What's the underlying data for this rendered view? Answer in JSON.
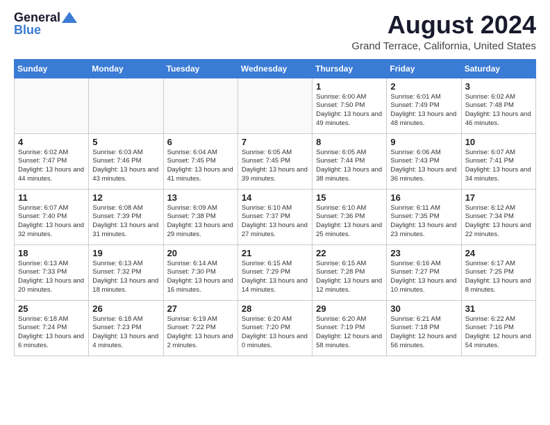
{
  "header": {
    "logo_line1": "General",
    "logo_line2": "Blue",
    "month_title": "August 2024",
    "location": "Grand Terrace, California, United States"
  },
  "days_of_week": [
    "Sunday",
    "Monday",
    "Tuesday",
    "Wednesday",
    "Thursday",
    "Friday",
    "Saturday"
  ],
  "weeks": [
    [
      {
        "day": "",
        "info": ""
      },
      {
        "day": "",
        "info": ""
      },
      {
        "day": "",
        "info": ""
      },
      {
        "day": "",
        "info": ""
      },
      {
        "day": "1",
        "info": "Sunrise: 6:00 AM\nSunset: 7:50 PM\nDaylight: 13 hours\nand 49 minutes."
      },
      {
        "day": "2",
        "info": "Sunrise: 6:01 AM\nSunset: 7:49 PM\nDaylight: 13 hours\nand 48 minutes."
      },
      {
        "day": "3",
        "info": "Sunrise: 6:02 AM\nSunset: 7:48 PM\nDaylight: 13 hours\nand 46 minutes."
      }
    ],
    [
      {
        "day": "4",
        "info": "Sunrise: 6:02 AM\nSunset: 7:47 PM\nDaylight: 13 hours\nand 44 minutes."
      },
      {
        "day": "5",
        "info": "Sunrise: 6:03 AM\nSunset: 7:46 PM\nDaylight: 13 hours\nand 43 minutes."
      },
      {
        "day": "6",
        "info": "Sunrise: 6:04 AM\nSunset: 7:45 PM\nDaylight: 13 hours\nand 41 minutes."
      },
      {
        "day": "7",
        "info": "Sunrise: 6:05 AM\nSunset: 7:45 PM\nDaylight: 13 hours\nand 39 minutes."
      },
      {
        "day": "8",
        "info": "Sunrise: 6:05 AM\nSunset: 7:44 PM\nDaylight: 13 hours\nand 38 minutes."
      },
      {
        "day": "9",
        "info": "Sunrise: 6:06 AM\nSunset: 7:43 PM\nDaylight: 13 hours\nand 36 minutes."
      },
      {
        "day": "10",
        "info": "Sunrise: 6:07 AM\nSunset: 7:41 PM\nDaylight: 13 hours\nand 34 minutes."
      }
    ],
    [
      {
        "day": "11",
        "info": "Sunrise: 6:07 AM\nSunset: 7:40 PM\nDaylight: 13 hours\nand 32 minutes."
      },
      {
        "day": "12",
        "info": "Sunrise: 6:08 AM\nSunset: 7:39 PM\nDaylight: 13 hours\nand 31 minutes."
      },
      {
        "day": "13",
        "info": "Sunrise: 6:09 AM\nSunset: 7:38 PM\nDaylight: 13 hours\nand 29 minutes."
      },
      {
        "day": "14",
        "info": "Sunrise: 6:10 AM\nSunset: 7:37 PM\nDaylight: 13 hours\nand 27 minutes."
      },
      {
        "day": "15",
        "info": "Sunrise: 6:10 AM\nSunset: 7:36 PM\nDaylight: 13 hours\nand 25 minutes."
      },
      {
        "day": "16",
        "info": "Sunrise: 6:11 AM\nSunset: 7:35 PM\nDaylight: 13 hours\nand 23 minutes."
      },
      {
        "day": "17",
        "info": "Sunrise: 6:12 AM\nSunset: 7:34 PM\nDaylight: 13 hours\nand 22 minutes."
      }
    ],
    [
      {
        "day": "18",
        "info": "Sunrise: 6:13 AM\nSunset: 7:33 PM\nDaylight: 13 hours\nand 20 minutes."
      },
      {
        "day": "19",
        "info": "Sunrise: 6:13 AM\nSunset: 7:32 PM\nDaylight: 13 hours\nand 18 minutes."
      },
      {
        "day": "20",
        "info": "Sunrise: 6:14 AM\nSunset: 7:30 PM\nDaylight: 13 hours\nand 16 minutes."
      },
      {
        "day": "21",
        "info": "Sunrise: 6:15 AM\nSunset: 7:29 PM\nDaylight: 13 hours\nand 14 minutes."
      },
      {
        "day": "22",
        "info": "Sunrise: 6:15 AM\nSunset: 7:28 PM\nDaylight: 13 hours\nand 12 minutes."
      },
      {
        "day": "23",
        "info": "Sunrise: 6:16 AM\nSunset: 7:27 PM\nDaylight: 13 hours\nand 10 minutes."
      },
      {
        "day": "24",
        "info": "Sunrise: 6:17 AM\nSunset: 7:25 PM\nDaylight: 13 hours\nand 8 minutes."
      }
    ],
    [
      {
        "day": "25",
        "info": "Sunrise: 6:18 AM\nSunset: 7:24 PM\nDaylight: 13 hours\nand 6 minutes."
      },
      {
        "day": "26",
        "info": "Sunrise: 6:18 AM\nSunset: 7:23 PM\nDaylight: 13 hours\nand 4 minutes."
      },
      {
        "day": "27",
        "info": "Sunrise: 6:19 AM\nSunset: 7:22 PM\nDaylight: 13 hours\nand 2 minutes."
      },
      {
        "day": "28",
        "info": "Sunrise: 6:20 AM\nSunset: 7:20 PM\nDaylight: 13 hours\nand 0 minutes."
      },
      {
        "day": "29",
        "info": "Sunrise: 6:20 AM\nSunset: 7:19 PM\nDaylight: 12 hours\nand 58 minutes."
      },
      {
        "day": "30",
        "info": "Sunrise: 6:21 AM\nSunset: 7:18 PM\nDaylight: 12 hours\nand 56 minutes."
      },
      {
        "day": "31",
        "info": "Sunrise: 6:22 AM\nSunset: 7:16 PM\nDaylight: 12 hours\nand 54 minutes."
      }
    ]
  ]
}
